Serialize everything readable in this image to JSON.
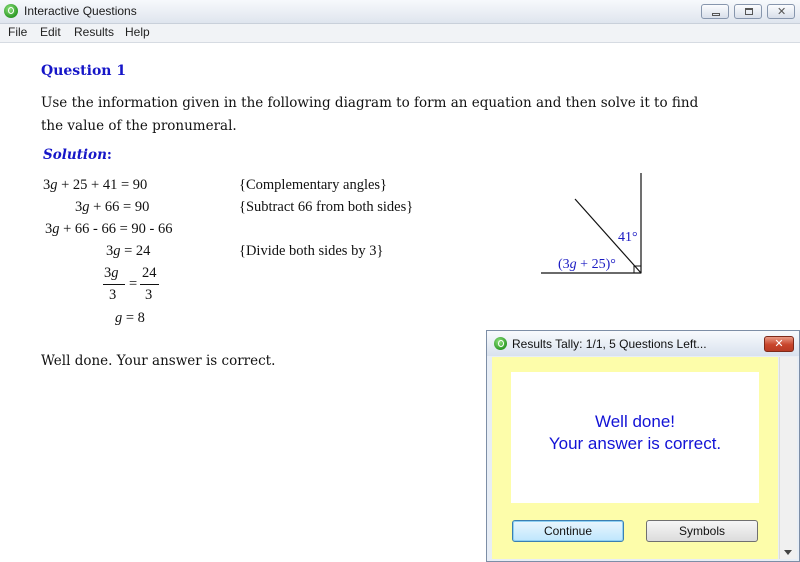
{
  "window": {
    "title": "Interactive Questions"
  },
  "menu": [
    "File",
    "Edit",
    "Results",
    "Help"
  ],
  "question": {
    "heading": "Question 1",
    "text": "Use the information given in the following diagram to form an equation and then solve it to find the value of the pronumeral."
  },
  "solution": {
    "heading": "Solution",
    "colon": ":",
    "steps": [
      {
        "lhs": "3g + 25 + 41 = 90",
        "reason": "{Complementary angles}"
      },
      {
        "lhs": "3g + 66 = 90",
        "reason": "{Subtract 66 from both sides}"
      },
      {
        "lhs": "3g + 66 - 66 = 90 - 66",
        "reason": ""
      },
      {
        "lhs": "3g = 24",
        "reason": "{Divide both sides by 3}"
      }
    ],
    "fraction_left": {
      "numerator": "3g",
      "denominator": "3"
    },
    "fraction_equals": "=",
    "fraction_right": {
      "numerator": "24",
      "denominator": "3"
    },
    "final": "g = 8"
  },
  "diagram": {
    "angle_top": "41°",
    "angle_bottom": "(3g + 25)°"
  },
  "feedback": "Well done.  Your answer is correct.",
  "results_dialog": {
    "title": "Results Tally: 1/1, 5 Questions Left...",
    "message_line1": "Well done!",
    "message_line2": "Your answer is correct.",
    "continue_label": "Continue",
    "symbols_label": "Symbols",
    "close_glyph": "✕"
  },
  "colors": {
    "heading_blue": "#1616c8",
    "message_blue": "#1212d6",
    "dialog_bg": "#fdfdaa"
  }
}
